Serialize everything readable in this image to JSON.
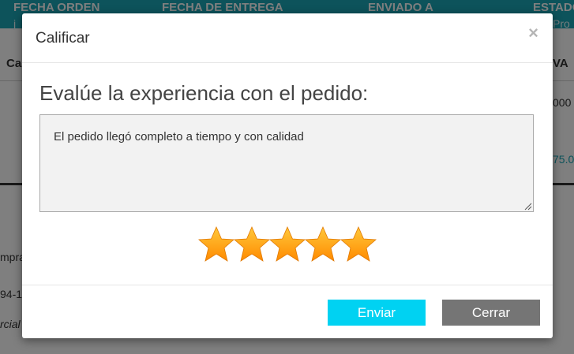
{
  "background": {
    "header_columns": [
      "FECHA ORDEN",
      "FECHA DE ENTREGA",
      "ENVIADO A",
      "ESTADO"
    ],
    "header_sub": [
      "j",
      "Pro"
    ],
    "table_head_left": "Ca",
    "table_head_right": "VA",
    "cell_right_1": "000",
    "cell_right_2": "75.0",
    "left_text_1": "mpra",
    "left_text_2": "94-13",
    "left_text_3": "rcial"
  },
  "modal": {
    "title": "Calificar",
    "close_symbol": "×",
    "question": "Evalúe la experiencia con el pedido:",
    "comment_value": "El pedido llegó completo a tiempo y con calidad",
    "rating": 5,
    "rating_max": 5,
    "send_label": "Enviar",
    "close_label": "Cerrar"
  },
  "colors": {
    "header_bg": "#1aa6b7",
    "send_button": "#00d2f2",
    "close_button": "#757575",
    "star_light": "#ffc83a",
    "star_dark": "#ff8a00"
  },
  "icons": {
    "star": "star-icon",
    "resize": "resize-grip-icon",
    "close": "close-icon"
  }
}
